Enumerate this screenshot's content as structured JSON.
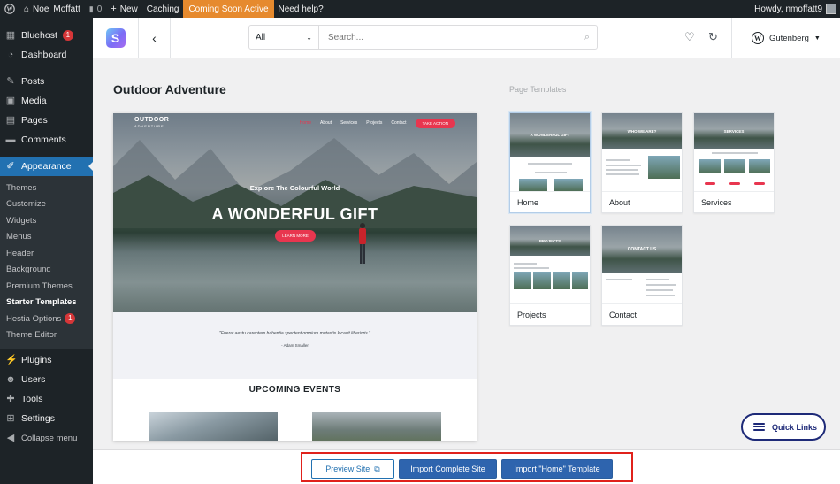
{
  "adminbar": {
    "site_name": "Noel Moffatt",
    "comments_count": "0",
    "new_label": "New",
    "caching_label": "Caching",
    "coming_soon_label": "Coming Soon Active",
    "help_label": "Need help?",
    "howdy_label": "Howdy, nmoffatt9"
  },
  "sidebar": {
    "bluehost": {
      "label": "Bluehost",
      "badge": "1"
    },
    "dashboard": "Dashboard",
    "posts": "Posts",
    "media": "Media",
    "pages": "Pages",
    "comments": "Comments",
    "appearance": "Appearance",
    "submenu": {
      "themes": "Themes",
      "customize": "Customize",
      "widgets": "Widgets",
      "menus": "Menus",
      "header": "Header",
      "background": "Background",
      "premium_themes": "Premium Themes",
      "starter_templates": "Starter Templates",
      "hestia_options": "Hestia Options",
      "hestia_badge": "1",
      "theme_editor": "Theme Editor"
    },
    "plugins": "Plugins",
    "users": "Users",
    "tools": "Tools",
    "settings": "Settings",
    "collapse": "Collapse menu"
  },
  "toolbar": {
    "logo_letter": "S",
    "filter_value": "All",
    "search_placeholder": "Search...",
    "builder_label": "Gutenberg"
  },
  "main": {
    "site_title": "Outdoor Adventure",
    "page_templates_label": "Page Templates",
    "preview": {
      "logo_line1": "OUTDOOR",
      "logo_line2": "ADVENTURE",
      "nav": [
        "Home",
        "About",
        "Services",
        "Projects",
        "Contact"
      ],
      "nav_button": "TAKE ACTION",
      "hero_subtitle": "Explore The Colourful World",
      "hero_title": "A WONDERFUL GIFT",
      "hero_cta": "LEARN MORE",
      "quote": "\"Fuerat aestu carentem habentia spectent omnium mutastis locavit liberioris.\"",
      "quote_author": "- Adam Smaller",
      "events_title": "UPCOMING EVENTS"
    },
    "templates": [
      {
        "name": "Home",
        "banner_text": "A WONDERFUL GIFT"
      },
      {
        "name": "About",
        "banner_text": "WHO WE ARE?"
      },
      {
        "name": "Services",
        "banner_text": "SERVICES"
      },
      {
        "name": "Projects",
        "banner_text": "PROJECTS"
      },
      {
        "name": "Contact",
        "banner_text": "CONTACT US"
      }
    ]
  },
  "quick_links_label": "Quick Links",
  "footer": {
    "preview_label": "Preview Site",
    "import_site_label": "Import Complete Site",
    "import_template_label": "Import \"Home\" Template"
  },
  "colors": {
    "admin_dark": "#1d2327",
    "wp_blue": "#2271b1",
    "coming_soon": "#e68a2e",
    "accent_red": "#e8364f",
    "highlight_red": "#e0211b"
  }
}
